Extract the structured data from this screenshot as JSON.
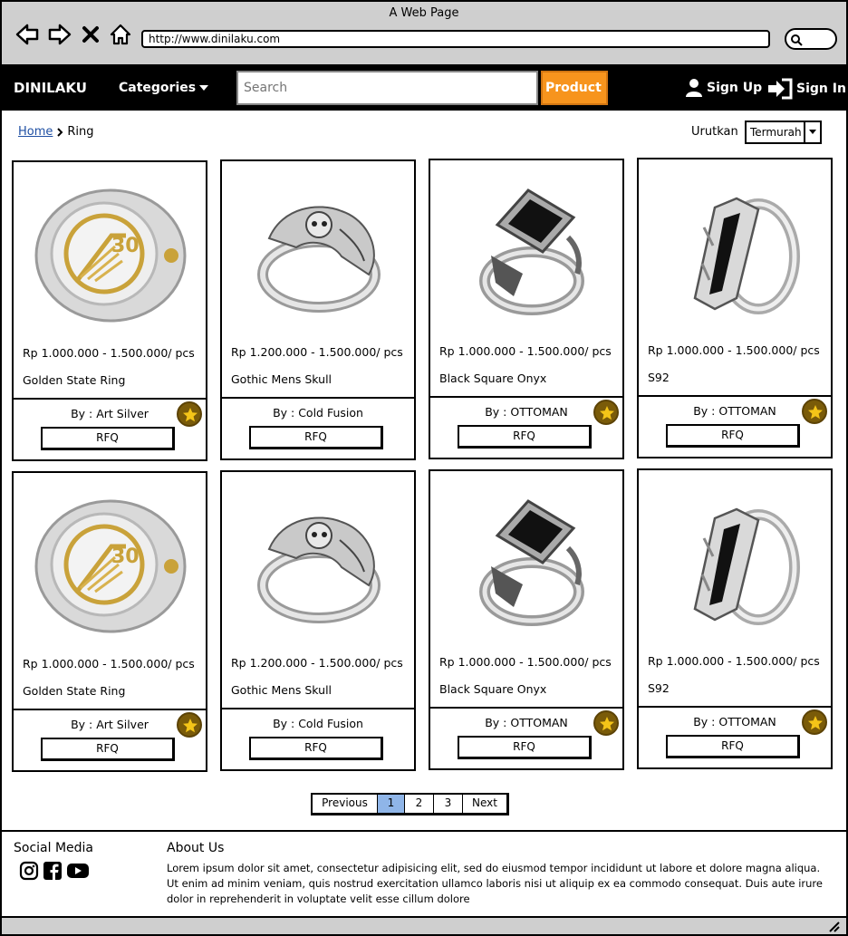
{
  "browser": {
    "window_title": "A Web Page",
    "url": "http://www.dinilaku.com"
  },
  "navbar": {
    "brand": "DINILAKU",
    "categories_label": "Categories",
    "search_placeholder": "Search",
    "product_label": "Product",
    "sign_up_label": "Sign Up",
    "sign_in_label": "Sign In"
  },
  "breadcrumb": {
    "home": "Home",
    "current": "Ring"
  },
  "sort": {
    "label": "Urutkan",
    "selected": "Termurah"
  },
  "products": [
    {
      "price": "Rp 1.000.000 - 1.500.000/ pcs",
      "name": "Golden State Ring",
      "by": "By : Art Silver",
      "rfq": "RFQ",
      "starred": true,
      "image": "gold-diamond-ring"
    },
    {
      "price": "Rp 1.200.000 - 1.500.000/ pcs",
      "name": "Gothic Mens Skull",
      "by": "By : Cold Fusion",
      "rfq": "RFQ",
      "starred": false,
      "image": "silver-skull-ring"
    },
    {
      "price": "Rp 1.000.000 - 1.500.000/ pcs",
      "name": "Black Square Onyx",
      "by": "By : OTTOMAN",
      "rfq": "RFQ",
      "starred": true,
      "image": "black-onyx-ring"
    },
    {
      "price": "Rp 1.000.000 - 1.500.000/ pcs",
      "name": "S92",
      "by": "By : OTTOMAN",
      "rfq": "RFQ",
      "starred": true,
      "image": "silver-s92-ring"
    },
    {
      "price": "Rp 1.000.000 - 1.500.000/ pcs",
      "name": "Golden State Ring",
      "by": "By : Art Silver",
      "rfq": "RFQ",
      "starred": true,
      "image": "gold-diamond-ring"
    },
    {
      "price": "Rp 1.200.000 - 1.500.000/ pcs",
      "name": "Gothic Mens Skull",
      "by": "By : Cold Fusion",
      "rfq": "RFQ",
      "starred": false,
      "image": "silver-skull-ring"
    },
    {
      "price": "Rp 1.000.000 - 1.500.000/ pcs",
      "name": "Black Square Onyx",
      "by": "By : OTTOMAN",
      "rfq": "RFQ",
      "starred": true,
      "image": "black-onyx-ring"
    },
    {
      "price": "Rp 1.000.000 - 1.500.000/ pcs",
      "name": "S92",
      "by": "By : OTTOMAN",
      "rfq": "RFQ",
      "starred": true,
      "image": "silver-s92-ring"
    }
  ],
  "pagination": {
    "previous": "Previous",
    "pages": [
      "1",
      "2",
      "3"
    ],
    "active_page": "1",
    "next": "Next"
  },
  "footer": {
    "social_title": "Social Media",
    "social_icons": [
      "instagram-icon",
      "facebook-icon",
      "youtube-icon"
    ],
    "about_title": "About Us",
    "about_text": "Lorem ipsum dolor sit amet, consectetur adipisicing elit, sed do eiusmod tempor incididunt ut labore et dolore magna aliqua. Ut enim ad minim veniam, quis nostrud exercitation ullamco laboris nisi ut aliquip ex ea commodo consequat. Duis aute irure dolor in reprehenderit in voluptate velit esse cillum dolore"
  },
  "colors": {
    "navbar_bg": "#000000",
    "product_button": "#f7941d",
    "active_page": "#8fb5e8",
    "star_badge": "#7a5b09",
    "chrome_gray": "#cfcfcf"
  }
}
